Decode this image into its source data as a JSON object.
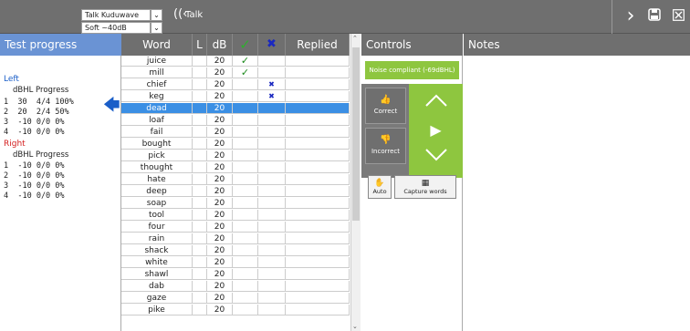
{
  "toolbar": {
    "voice_select": "Talk Kuduwave",
    "level_select": "Soft ~40dB",
    "talk_label": "Talk",
    "icons": {
      "talk": "talk-wave-icon",
      "next": "chevron-right-icon",
      "save": "save-icon",
      "close": "close-icon"
    }
  },
  "test_progress": {
    "title": "Test progress",
    "left_label": "Left",
    "right_label": "Right",
    "col_header": "dBHL Progress",
    "left_rows": [
      "1  30  4/4 100%",
      "2  20  2/4 50%",
      "3  -10 0/0 0%",
      "4  -10 0/0 0%"
    ],
    "right_rows": [
      "1  -10 0/0 0%",
      "2  -10 0/0 0%",
      "3  -10 0/0 0%",
      "4  -10 0/0 0%"
    ],
    "current_row_indicator": "arrow-left-icon"
  },
  "word_table": {
    "headers": {
      "word": "Word",
      "l": "L",
      "db": "dB",
      "replied": "Replied"
    },
    "rows": [
      {
        "word": "juice",
        "db": "20",
        "result": "correct"
      },
      {
        "word": "mill",
        "db": "20",
        "result": "correct"
      },
      {
        "word": "chief",
        "db": "20",
        "result": "incorrect"
      },
      {
        "word": "keg",
        "db": "20",
        "result": "incorrect"
      },
      {
        "word": "dead",
        "db": "20",
        "result": "",
        "selected": true
      },
      {
        "word": "loaf",
        "db": "20",
        "result": ""
      },
      {
        "word": "fail",
        "db": "20",
        "result": ""
      },
      {
        "word": "bought",
        "db": "20",
        "result": ""
      },
      {
        "word": "pick",
        "db": "20",
        "result": ""
      },
      {
        "word": "thought",
        "db": "20",
        "result": ""
      },
      {
        "word": "hate",
        "db": "20",
        "result": ""
      },
      {
        "word": "deep",
        "db": "20",
        "result": ""
      },
      {
        "word": "soap",
        "db": "20",
        "result": ""
      },
      {
        "word": "tool",
        "db": "20",
        "result": ""
      },
      {
        "word": "four",
        "db": "20",
        "result": ""
      },
      {
        "word": "rain",
        "db": "20",
        "result": ""
      },
      {
        "word": "shack",
        "db": "20",
        "result": ""
      },
      {
        "word": "white",
        "db": "20",
        "result": ""
      },
      {
        "word": "shawl",
        "db": "20",
        "result": ""
      },
      {
        "word": "dab",
        "db": "20",
        "result": ""
      },
      {
        "word": "gaze",
        "db": "20",
        "result": ""
      },
      {
        "word": "pike",
        "db": "20",
        "result": ""
      }
    ]
  },
  "controls": {
    "title": "Controls",
    "noise_status": "Noise compliant (-69dBHL)",
    "correct_label": "Correct",
    "incorrect_label": "Incorrect",
    "auto_label": "Auto",
    "capture_label": "Capture words"
  },
  "notes": {
    "title": "Notes"
  },
  "colors": {
    "accent_blue": "#6a93d4",
    "selection": "#3b8fe4",
    "green": "#8ec63f",
    "toolbar": "#6f6f6f"
  }
}
